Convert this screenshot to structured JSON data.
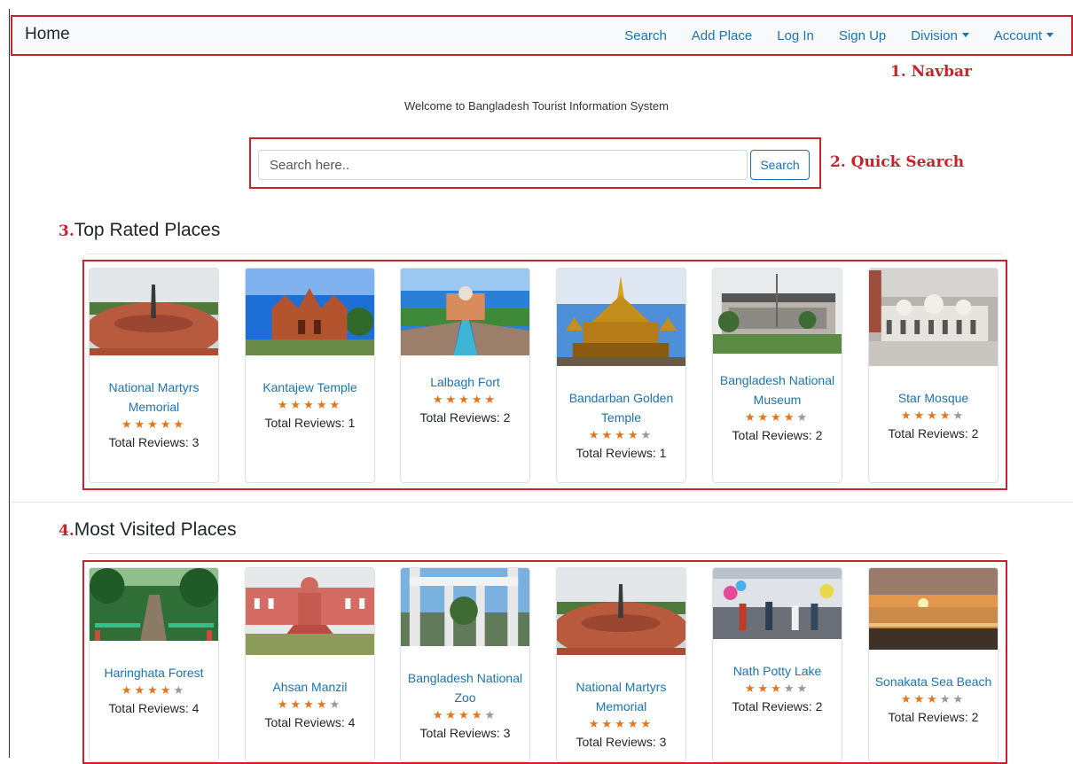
{
  "navbar": {
    "brand": "Home",
    "links": [
      "Search",
      "Add Place",
      "Log In",
      "Sign Up"
    ],
    "division_label": "Division",
    "account_label": "Account"
  },
  "annotations": {
    "navbar": "1. Navbar",
    "quick_search": "2. Quick Search"
  },
  "welcome": "Welcome to Bangladesh Tourist Information System",
  "search": {
    "placeholder": "Search here..",
    "button": "Search"
  },
  "sections": {
    "top_rated": {
      "num": "3.",
      "title": "Top Rated Places"
    },
    "most_visited": {
      "num": "4.",
      "title": "Most Visited Places"
    }
  },
  "reviews_prefix": "Total Reviews: ",
  "top_rated": [
    {
      "name": "National Martyrs Memorial",
      "rating": 5,
      "reviews": 3,
      "image": "memorial"
    },
    {
      "name": "Kantajew Temple",
      "rating": 5,
      "reviews": 1,
      "image": "temple"
    },
    {
      "name": "Lalbagh Fort",
      "rating": 5,
      "reviews": 2,
      "image": "fort"
    },
    {
      "name": "Bandarban Golden Temple",
      "rating": 4,
      "reviews": 1,
      "image": "golden"
    },
    {
      "name": "Bangladesh National Museum",
      "rating": 4,
      "reviews": 2,
      "image": "museum"
    },
    {
      "name": "Star Mosque",
      "rating": 4,
      "reviews": 2,
      "image": "mosque"
    }
  ],
  "most_visited": [
    {
      "name": "Haringhata Forest",
      "rating": 4,
      "reviews": 4,
      "image": "forest"
    },
    {
      "name": "Ahsan Manzil",
      "rating": 4,
      "reviews": 4,
      "image": "manzil"
    },
    {
      "name": "Bangladesh National Zoo",
      "rating": 4,
      "reviews": 3,
      "image": "zoo"
    },
    {
      "name": "National Martyrs Memorial",
      "rating": 5,
      "reviews": 3,
      "image": "memorial"
    },
    {
      "name": "Nath Potty Lake",
      "rating": 3,
      "reviews": 2,
      "image": "lake"
    },
    {
      "name": "Sonakata Sea Beach",
      "rating": 3,
      "reviews": 2,
      "image": "beach"
    }
  ],
  "colors": {
    "accent": "#1a73b5",
    "annotation": "#c8232c",
    "star": "#e8741a"
  }
}
